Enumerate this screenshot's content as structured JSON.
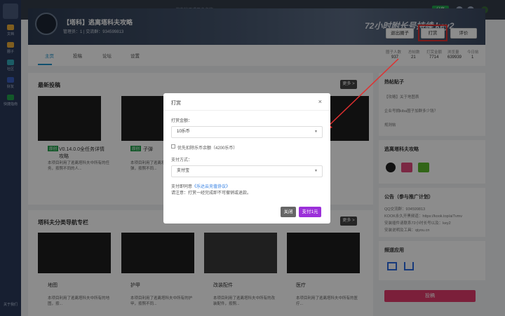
{
  "sidebar": {
    "items": [
      {
        "label": "文档"
      },
      {
        "label": "圈子"
      },
      {
        "label": "社区"
      },
      {
        "label": "好友"
      },
      {
        "label": "快捷指南"
      }
    ],
    "bottom": {
      "label": "关于我们"
    }
  },
  "topbar": {
    "search_placeholder": "搜索帖子或用户名称",
    "share_label": "分享"
  },
  "banner": {
    "title": "【塔科】逃离塔科夫攻略",
    "subtitle": "管理员：1 | 交流群：934599813",
    "slogan": "72小时附长号持续 key2",
    "exit_button": "退出圈子",
    "tip_button": "打赏",
    "rate_button": "评价"
  },
  "tabs": {
    "items": [
      "主页",
      "投稿",
      "论坛",
      "设置"
    ]
  },
  "stats": {
    "labels": [
      "圈子人数",
      "总帖数",
      "打赏金额",
      "浏览量",
      "今日帖"
    ],
    "values": [
      "937",
      "21",
      "7714",
      "639939",
      "1"
    ]
  },
  "latest_posts": {
    "title": "最新投稿",
    "more": "更多 >",
    "cards": [
      {
        "tag": "原创",
        "title": "V0.14.0.0全任务详情攻略",
        "desc": "本项目利用了逃离塔科夫中所有的任务，按照不同的人..."
      },
      {
        "tag": "原创",
        "title": "子弹",
        "desc": "本项目利用了逃离塔科夫中所有的子弹，按照不同..."
      }
    ]
  },
  "category_nav": {
    "title": "塔科夫分类导航专栏",
    "more": "更多 >",
    "cards": [
      {
        "title": "地图",
        "desc": "本项目利用了逃离塔科夫中所有的地图，按..."
      },
      {
        "title": "护甲",
        "desc": "本项目利用了逃离塔科夫中所有的护甲，按照不同..."
      },
      {
        "title": "改装配件",
        "desc": "本项目利用了逃离塔科夫中所有的改装配件，按照..."
      },
      {
        "title": "医疗",
        "desc": "本项目利用了逃离塔科夫中所有的医疗..."
      }
    ]
  },
  "right": {
    "hot_title": "热帖贴子",
    "hot_items": [
      "【攻略】关于地图表",
      "企业号拥kiba圈子加群多少钱？",
      "规则帖"
    ],
    "gonglue_title": "逃离塔科夫攻略",
    "notice_title": "公告（参与推广计划）",
    "notice_lines": [
      "QQ交流群：934599813",
      "KOOK永久开黑频道：https://kook.top/aiTvmv",
      "安装插件请联系72小时长号以及：key2",
      "安装说明及工具：qiyou.cn"
    ],
    "apps_title": "频道应用",
    "pink_button": "投稿"
  },
  "modal": {
    "title": "打赏",
    "close": "×",
    "amount_label": "打赏金额：",
    "amount_value": "10乐币",
    "balance_label": "优先扣除乐币余额（4200乐币）",
    "method_label": "支付方式：",
    "method_value": "支付宝",
    "agree_prefix": "支付即同意",
    "agree_link": "《乐达云充值协议》",
    "note": "请注意：打赏一经完成即不可撤销或退款。",
    "close_button": "关闭",
    "pay_button": "支付1元"
  },
  "colors": {
    "accent": "#1e90c8",
    "pay_purple": "#9b30d9",
    "pink": "#e0396b",
    "highlight_red": "#e03030"
  }
}
